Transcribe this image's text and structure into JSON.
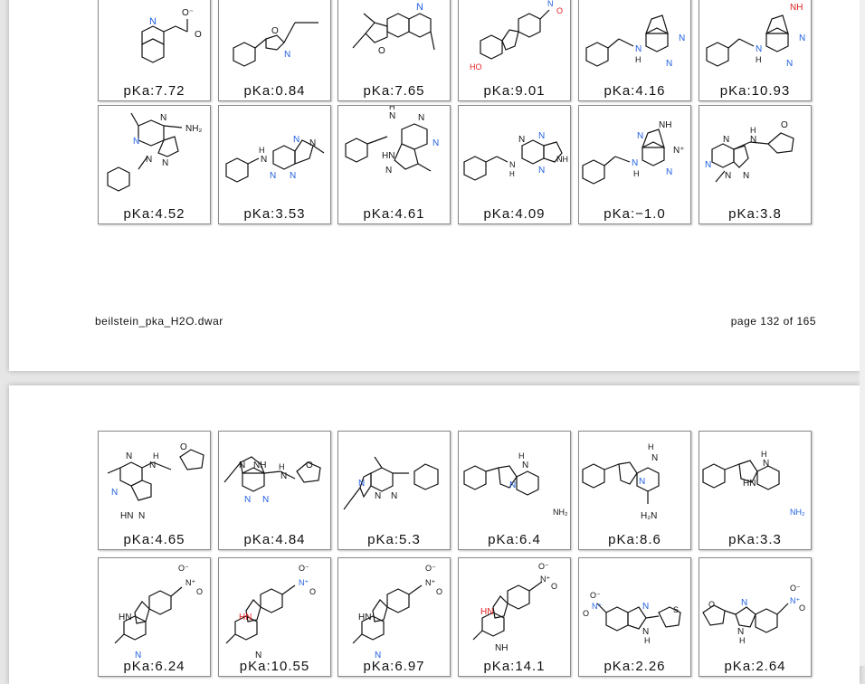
{
  "page1": {
    "file_name": "beilstein_pka_H2O.dwar",
    "page_label": "page 132 of 165",
    "row1": [
      "pKa:7.72",
      "pKa:0.84",
      "pKa:7.65",
      "pKa:9.01",
      "pKa:4.16",
      "pKa:10.93"
    ],
    "row2": [
      "pKa:4.52",
      "pKa:3.53",
      "pKa:4.61",
      "pKa:4.09",
      "pKa:−1.0",
      "pKa:3.8"
    ]
  },
  "page2": {
    "row1": [
      "pKa:4.65",
      "pKa:4.84",
      "pKa:5.3",
      "pKa:6.4",
      "pKa:8.6",
      "pKa:3.3"
    ],
    "row2": [
      "pKa:6.24",
      "pKa:10.55",
      "pKa:6.97",
      "pKa:14.1",
      "pKa:2.26",
      "pKa:2.64"
    ]
  },
  "colors": {
    "nitrogen": "#2060e0",
    "oxygen": "#e02020",
    "bond": "#111111"
  }
}
